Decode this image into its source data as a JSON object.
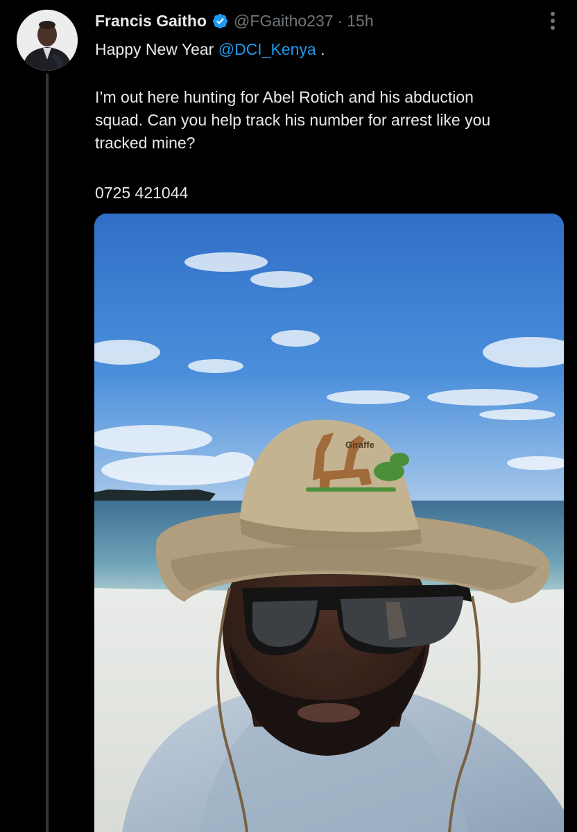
{
  "author": {
    "name": "Francis Gaitho",
    "handle": "@FGaitho237",
    "time": "15h"
  },
  "post": {
    "line1_prefix": "Happy New Year ",
    "mention": "@DCI_Kenya",
    "line1_suffix": " .",
    "para2_line1": "I’m out here hunting for Abel Rotich and his abduction",
    "para2_line2": "squad. Can you help track his number for arrest like you",
    "para2_line3": "tracked mine?",
    "phone": "0725 421044"
  },
  "media": {
    "hat_text": "Giraffe"
  },
  "colors": {
    "background": "#000000",
    "text": "#e7e9ea",
    "secondary": "#71767b",
    "accent": "#1d9bf0"
  },
  "icons": {
    "verified": "verified-badge-icon",
    "more": "more-options-icon"
  }
}
